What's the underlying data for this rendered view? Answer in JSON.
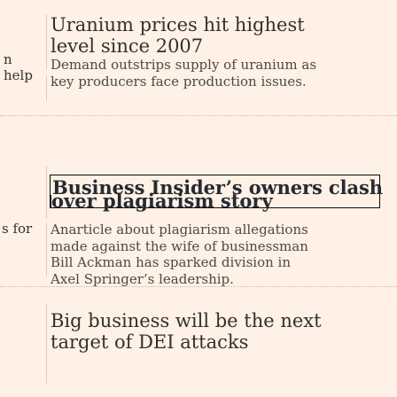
{
  "left_column": {
    "fragment_1": "n",
    "fragment_2": "help",
    "fragment_3": "s for"
  },
  "stories": [
    {
      "headline": "Uranium prices hit highest level since 2007",
      "standfirst": "Demand outstrips supply of uranium as key producers face production issues."
    },
    {
      "headline_line1": "Business Insider’s owners clash",
      "headline_line2": "over plagiarism story",
      "standfirst": "Anarticle about plagiarism allegations made against the wife of businessman Bill Ackman has sparked division in Axel Springer’s leadership."
    },
    {
      "headline": "Big business will be the next target of DEI attacks"
    }
  ]
}
